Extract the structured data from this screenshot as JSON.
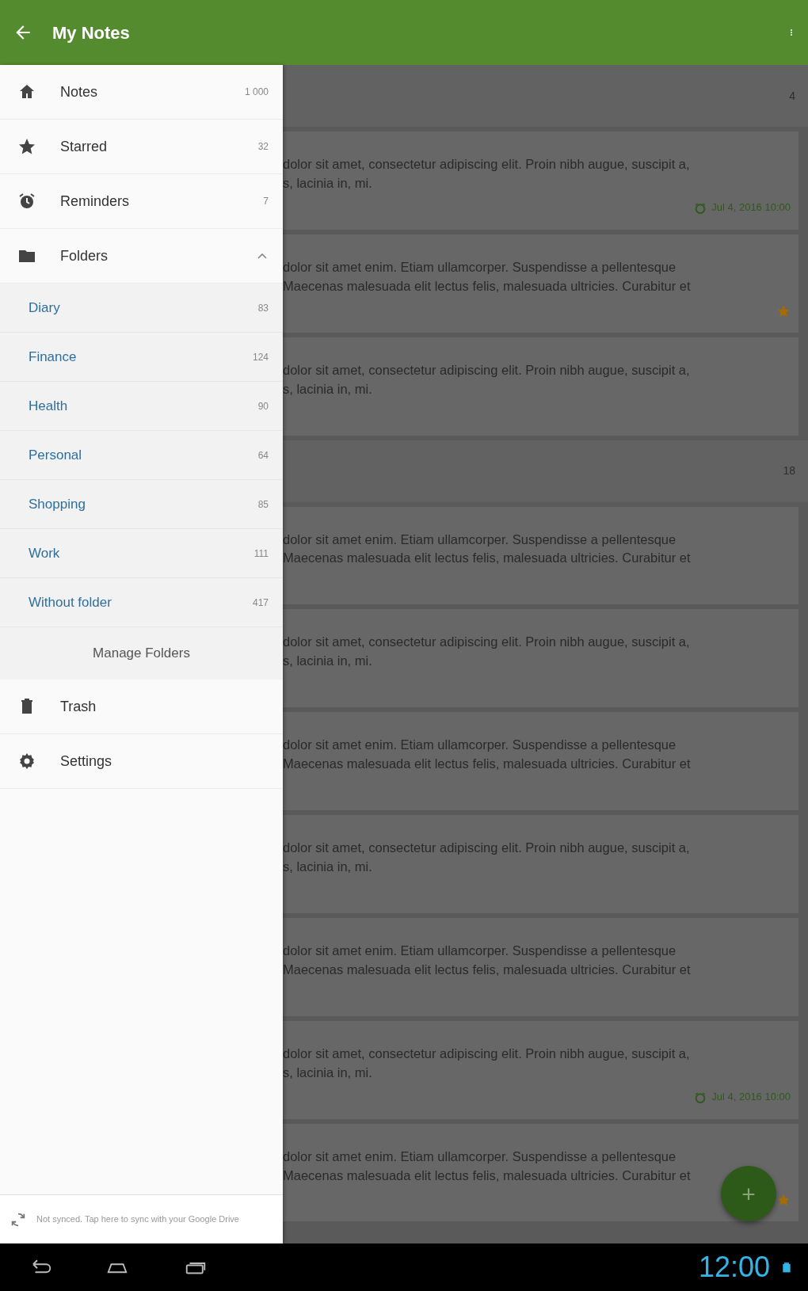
{
  "app_bar": {
    "title": "My Notes"
  },
  "drawer": {
    "items": [
      {
        "label": "Notes",
        "count": "1 000"
      },
      {
        "label": "Starred",
        "count": "32"
      },
      {
        "label": "Reminders",
        "count": "7"
      },
      {
        "label": "Folders",
        "expanded": true,
        "children": [
          {
            "label": "Diary",
            "count": "83"
          },
          {
            "label": "Finance",
            "count": "124"
          },
          {
            "label": "Health",
            "count": "90"
          },
          {
            "label": "Personal",
            "count": "64"
          },
          {
            "label": "Shopping",
            "count": "85"
          },
          {
            "label": "Work",
            "count": "111"
          },
          {
            "label": "Without folder",
            "count": "417"
          }
        ],
        "manage": "Manage Folders"
      },
      {
        "label": "Trash"
      },
      {
        "label": "Settings"
      }
    ],
    "sync_text": "Not synced. Tap here to sync with your Google Drive"
  },
  "notes": [
    {
      "kind": "header",
      "count": "4"
    },
    {
      "kind": "note",
      "lines": [
        "dolor sit amet, consectetur adipiscing elit. Proin nibh augue, suscipit a,",
        "s, lacinia in, mi."
      ],
      "reminder": "Jul 4, 2016 10:00",
      "starred": false
    },
    {
      "kind": "note",
      "lines": [
        "dolor sit amet enim. Etiam ullamcorper. Suspendisse a pellentesque",
        "Maecenas malesuada elit lectus felis, malesuada ultricies. Curabitur et"
      ],
      "starred": true
    },
    {
      "kind": "note",
      "lines": [
        "dolor sit amet, consectetur adipiscing elit. Proin nibh augue, suscipit a,",
        "s, lacinia in, mi."
      ],
      "starred": false
    },
    {
      "kind": "header",
      "count": "18"
    },
    {
      "kind": "note",
      "lines": [
        "dolor sit amet enim. Etiam ullamcorper. Suspendisse a pellentesque",
        "Maecenas malesuada elit lectus felis, malesuada ultricies. Curabitur et"
      ],
      "starred": false
    },
    {
      "kind": "note",
      "lines": [
        "dolor sit amet, consectetur adipiscing elit. Proin nibh augue, suscipit a,",
        "s, lacinia in, mi."
      ],
      "starred": false
    },
    {
      "kind": "note",
      "lines": [
        "dolor sit amet enim. Etiam ullamcorper. Suspendisse a pellentesque",
        "Maecenas malesuada elit lectus felis, malesuada ultricies. Curabitur et"
      ],
      "starred": false
    },
    {
      "kind": "note",
      "lines": [
        "dolor sit amet, consectetur adipiscing elit. Proin nibh augue, suscipit a,",
        "s, lacinia in, mi."
      ],
      "starred": false
    },
    {
      "kind": "note",
      "lines": [
        "dolor sit amet enim. Etiam ullamcorper. Suspendisse a pellentesque",
        "Maecenas malesuada elit lectus felis, malesuada ultricies. Curabitur et"
      ],
      "starred": false
    },
    {
      "kind": "note",
      "lines": [
        "dolor sit amet, consectetur adipiscing elit. Proin nibh augue, suscipit a,",
        "s, lacinia in, mi."
      ],
      "reminder": "Jul 4, 2016 10:00",
      "starred": false
    },
    {
      "kind": "note",
      "lines": [
        "dolor sit amet enim. Etiam ullamcorper. Suspendisse a pellentesque",
        "Maecenas malesuada elit lectus felis, malesuada ultricies. Curabitur et"
      ],
      "starred": true
    }
  ],
  "fab": {
    "label": "+"
  },
  "system_bar": {
    "time": "12:00"
  }
}
